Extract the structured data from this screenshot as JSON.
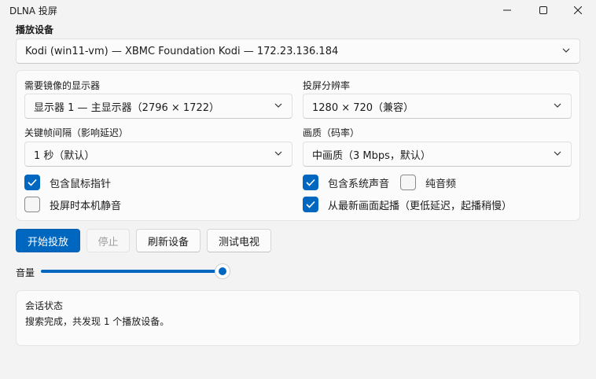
{
  "window": {
    "title": "DLNA 投屏"
  },
  "device": {
    "label": "播放设备",
    "selected": "Kodi (win11-vm) — XBMC Foundation Kodi — 172.23.136.184"
  },
  "settings": {
    "display_label": "需要镜像的显示器",
    "display_value": "显示器 1 — 主显示器（2796 × 1722）",
    "resolution_label": "投屏分辨率",
    "resolution_value": "1280 × 720（兼容）",
    "keyframe_label": "关键帧间隔（影响延迟）",
    "keyframe_value": "1 秒（默认）",
    "quality_label": "画质（码率）",
    "quality_value": "中画质（3 Mbps，默认）"
  },
  "options": {
    "include_cursor": {
      "label": "包含鼠标指针",
      "checked": true
    },
    "mute_local": {
      "label": "投屏时本机静音",
      "checked": false
    },
    "include_system_audio": {
      "label": "包含系统声音",
      "checked": true
    },
    "audio_only": {
      "label": "纯音频",
      "checked": false
    },
    "play_from_latest": {
      "label": "从最新画面起播（更低延迟，起播稍慢）",
      "checked": true
    }
  },
  "actions": {
    "start": "开始投放",
    "stop": "停止",
    "refresh": "刷新设备",
    "test_tv": "测试电视"
  },
  "volume": {
    "label": "音量",
    "level": 1.0
  },
  "session": {
    "title": "会话状态",
    "message": "搜索完成，共发现 1 个播放设备。"
  },
  "colors": {
    "accent": "#0067c0",
    "window_bg": "#f3f3f3",
    "panel_bg": "#fbfbfb"
  }
}
